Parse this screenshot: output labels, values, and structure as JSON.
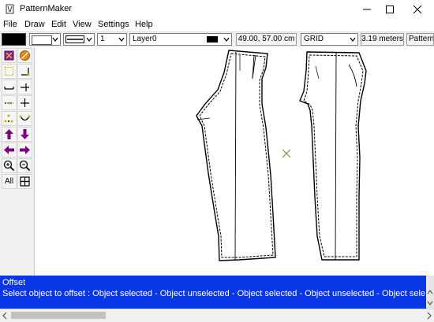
{
  "window": {
    "title": "PatternMaker",
    "app_icon": "pattern-app-icon",
    "controls": [
      "minimize-icon",
      "maximize-icon",
      "close-icon"
    ]
  },
  "menu": {
    "items": [
      "File",
      "Draw",
      "Edit",
      "View",
      "Settings",
      "Help"
    ]
  },
  "toolbar": {
    "line_weight": "1",
    "layer": "Layer0",
    "coordinates": "49.00, 57.00 cm",
    "snap_mode": "GRID",
    "measure": "3.19 meters",
    "app_label": "PatternMaker"
  },
  "tools": [
    {
      "name": "book-icon"
    },
    {
      "name": "no-symbol-icon"
    },
    {
      "name": "dotted-select-icon"
    },
    {
      "name": "corner-icon"
    },
    {
      "name": "line-icon"
    },
    {
      "name": "cross-line-icon"
    },
    {
      "name": "dotted-line-icon"
    },
    {
      "name": "plus-icon"
    },
    {
      "name": "dots-icon"
    },
    {
      "name": "curve-icon"
    },
    {
      "name": "arrow-up-icon"
    },
    {
      "name": "arrow-down-icon"
    },
    {
      "name": "arrow-left-icon"
    },
    {
      "name": "arrow-right-icon"
    },
    {
      "name": "zoom-in-icon"
    },
    {
      "name": "zoom-out-icon"
    },
    {
      "name": "all-label",
      "label": "All"
    },
    {
      "name": "grid-icon"
    }
  ],
  "status": {
    "mode": "Offset",
    "message": "Select object to offset :   Object selected - Object unselected - Object selected - Object unselected - Object sele"
  },
  "colors": {
    "status_bg": "#0a37e6",
    "accent_purple": "#800080",
    "yellow": "#c8b400",
    "cursor_olive": "#8a8a3a"
  }
}
